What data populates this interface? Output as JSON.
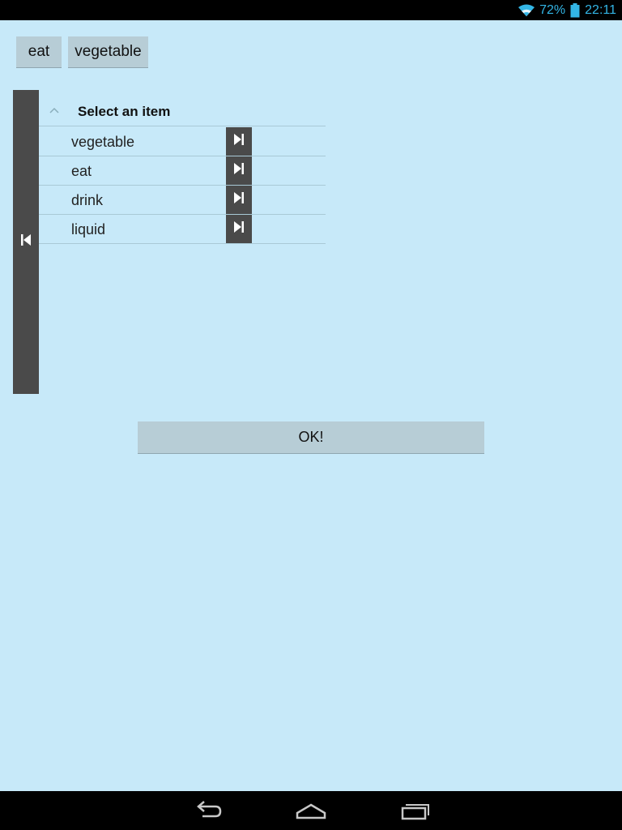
{
  "status_bar": {
    "battery": "72%",
    "time": "22:11",
    "icons": [
      "wifi-icon",
      "battery-icon"
    ]
  },
  "chips": [
    {
      "label": "eat"
    },
    {
      "label": "vegetable"
    }
  ],
  "list": {
    "title": "Select an item",
    "items": [
      {
        "label": "vegetable"
      },
      {
        "label": "eat"
      },
      {
        "label": "drink"
      },
      {
        "label": "liquid"
      }
    ]
  },
  "ok_button": {
    "label": "OK!"
  },
  "colors": {
    "background": "#c7e9f9",
    "button": "#b7cdd6",
    "panel": "#4a4a4a",
    "status_accent": "#33b5e5"
  },
  "nav_bar": {
    "icons": [
      "back-icon",
      "home-icon",
      "recent-apps-icon"
    ]
  }
}
